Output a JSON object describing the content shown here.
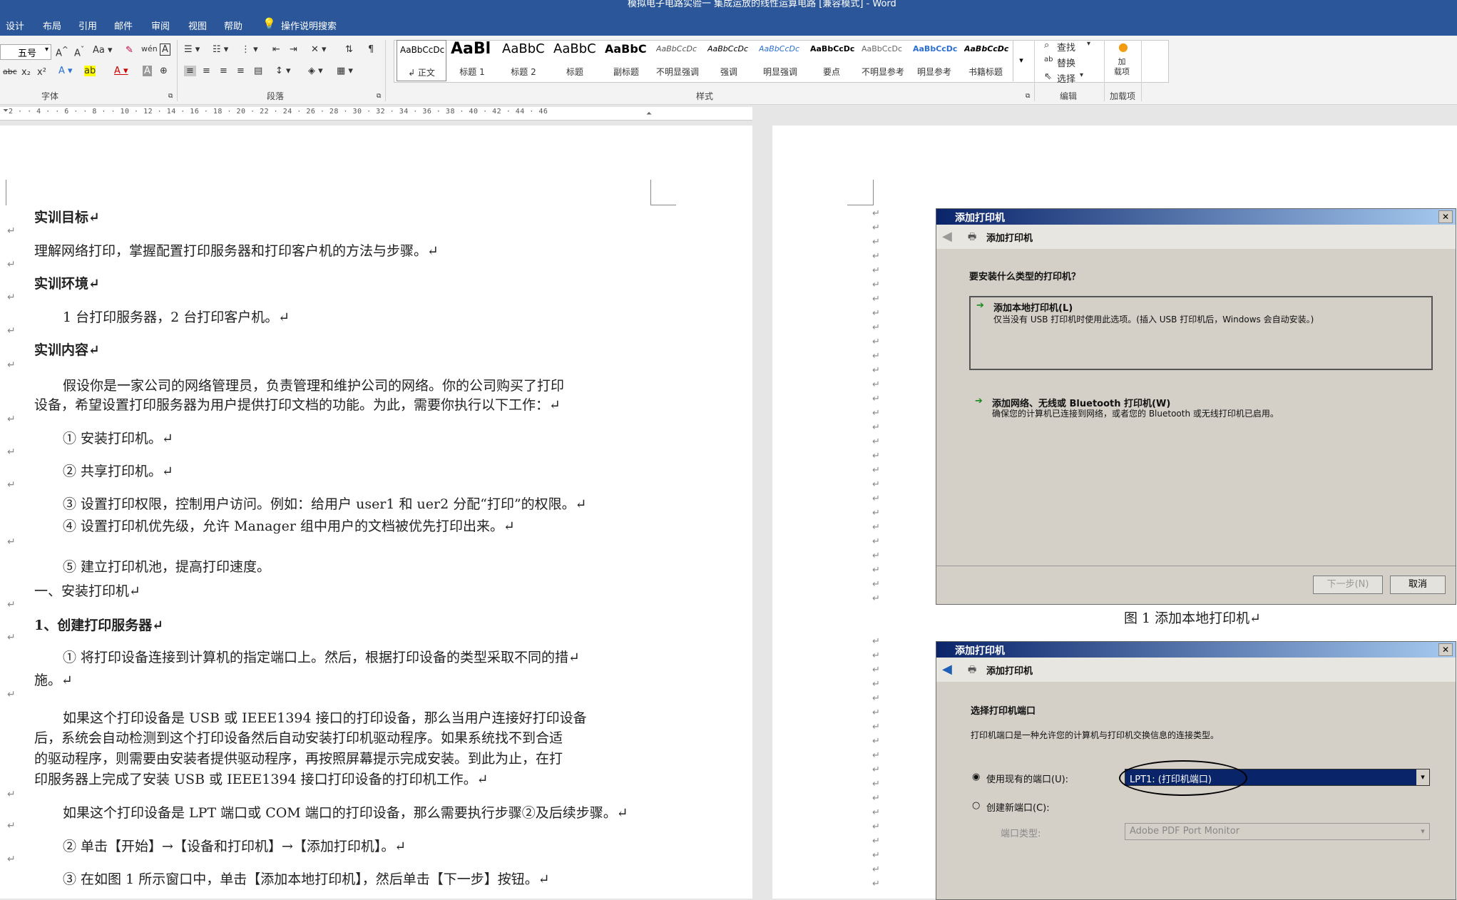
{
  "window": {
    "title": "模拟电子电路实验一 集成运放的线性运算电路 [兼容模式] - Word"
  },
  "tabs": [
    "设计",
    "布局",
    "引用",
    "邮件",
    "审阅",
    "视图",
    "帮助"
  ],
  "search": {
    "label": "操作说明搜索"
  },
  "font": {
    "size": "五号",
    "group_label": "字体"
  },
  "paragraph": {
    "group_label": "段落"
  },
  "styles": {
    "group_label": "样式",
    "items": [
      {
        "sample": "AaBbCcDc",
        "name": "↲ 正文"
      },
      {
        "sample": "AaBl",
        "name": "标题 1"
      },
      {
        "sample": "AaBbC",
        "name": "标题 2"
      },
      {
        "sample": "AaBbC",
        "name": "标题"
      },
      {
        "sample": "AaBbC",
        "name": "副标题"
      },
      {
        "sample": "AaBbCcDc",
        "name": "不明显强调"
      },
      {
        "sample": "AaBbCcDc",
        "name": "强调"
      },
      {
        "sample": "AaBbCcDc",
        "name": "明显强调"
      },
      {
        "sample": "AaBbCcDc",
        "name": "要点"
      },
      {
        "sample": "AaBbCcDc",
        "name": "不明显参考"
      },
      {
        "sample": "AaBbCcDc",
        "name": "明显参考"
      },
      {
        "sample": "AaBbCcDc",
        "name": "书籍标题"
      }
    ]
  },
  "editing": {
    "find": "查找",
    "replace": "替换",
    "select": "选择",
    "group_label": "编辑"
  },
  "addins": {
    "label": "加\n载项",
    "group_label": "加载项"
  },
  "ruler": {
    "marks": "2 · · 4 · · 6 · · 8 · · 10 · 12 · 14 · 16 · 18 · 20 · 22 · 24 · 26 · 28 · 30 · 32 · 34 · 36 · 38 · 40 · 42 · 44 · 46"
  },
  "document": {
    "lines": [
      "实训目标↵",
      "理解网络打印，掌握配置打印服务器和打印客户机的方法与步骤。↵",
      "实训环境↵",
      "1 台打印服务器，2 台打印客户机。↵",
      "实训内容↵",
      "假设你是一家公司的网络管理员，负责管理和维护公司的网络。你的公司购买了打印",
      "设备，希望设置打印服务器为用户提供打印文档的功能。为此，需要你执行以下工作：↵",
      "①  安装打印机。↵",
      "②  共享打印机。↵",
      "③  设置打印权限，控制用户访问。例如：给用户 user1 和 uer2 分配“打印”的权限。↵",
      "④  设置打印机优先级，允许 Manager 组中用户的文档被优先打印出来。↵",
      "⑤  建立打印机池，提高打印速度。",
      "一、安装打印机↵",
      "1、创建打印服务器↵",
      "① 将打印设备连接到计算机的指定端口上。然后，根据打印设备的类型采取不同的措↵",
      "施。↵",
      "如果这个打印设备是 USB 或 IEEE1394 接口的打印设备，那么当用户连接好打印设备",
      "后，系统会自动检测到这个打印设备然后自动安装打印机驱动程序。如果系统找不到合适",
      "的驱动程序，则需要由安装者提供驱动程序，再按照屏幕提示完成安装。到此为止，在打",
      "印服务器上完成了安装 USB 或 IEEE1394 接口打印设备的打印机工作。↵",
      "如果这个打印设备是 LPT 端口或 COM 端口的打印设备，那么需要执行步骤②及后续步骤。↵",
      "② 单击【开始】→【设备和打印机】→【添加打印机】。↵",
      "③ 在如图 1 所示窗口中，单击【添加本地打印机】，然后单击【下一步】按钮。↵"
    ]
  },
  "dialog1": {
    "title": "添加打印机",
    "header": "添加打印机",
    "question": "要安装什么类型的打印机？",
    "opt1_title": "添加本地打印机(L)",
    "opt1_desc": "仅当没有 USB 打印机时使用此选项。(插入 USB 打印机后，Windows 会自动安装。)",
    "opt2_title": "添加网络、无线或 Bluetooth 打印机(W)",
    "opt2_desc": "确保您的计算机已连接到网络，或者您的 Bluetooth 或无线打印机已启用。",
    "next": "下一步(N)",
    "cancel": "取消",
    "caption": "图 1 添加本地打印机↵"
  },
  "dialog2": {
    "title": "添加打印机",
    "header": "添加打印机",
    "heading": "选择打印机端口",
    "desc": "打印机端口是一种允许您的计算机与打印机交换信息的连接类型。",
    "use_existing": "使用现有的端口(U):",
    "port_value": "LPT1: (打印机端口)",
    "create_new": "创建新端口(C):",
    "port_type_label": "端口类型:",
    "port_type_value": "Adobe PDF Port Monitor"
  },
  "colors": {
    "brand": "#2b579a",
    "selection": "#0a246a"
  }
}
